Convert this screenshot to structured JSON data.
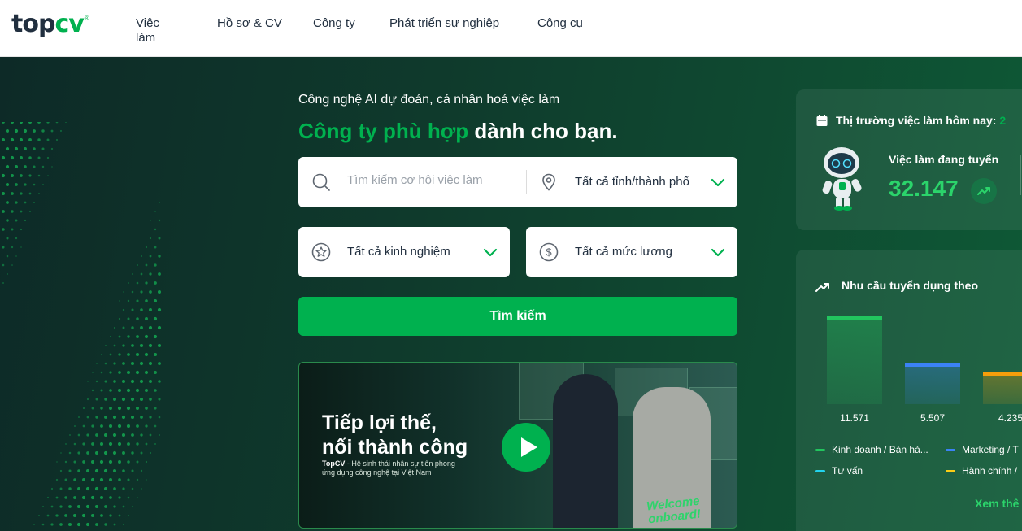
{
  "header": {
    "logo_top": "top",
    "logo_cv": "cv",
    "nav": [
      "Việc làm",
      "Hồ sơ & CV",
      "Công ty",
      "Phát triển sự nghiệp",
      "Công cụ"
    ]
  },
  "hero": {
    "tagline": "Công nghệ AI dự đoán, cá nhân hoá việc làm",
    "headline_accent": "Công ty phù hợp",
    "headline_rest": " dành cho bạn."
  },
  "search": {
    "placeholder": "Tìm kiếm cơ hội việc làm",
    "location": "Tất cả tỉnh/thành phố",
    "experience": "Tất cả kinh nghiệm",
    "salary": "Tất cả mức lương",
    "button": "Tìm kiếm"
  },
  "banner": {
    "title1": "Tiếp lợi thế,",
    "title2": "nối thành công",
    "sub_brand": "TopCV",
    "sub_text": " - Hệ sinh thái nhân sự tiên phong ứng dụng công nghệ tại Việt Nam",
    "welcome1": "Welcome",
    "welcome2": "onboard!"
  },
  "market": {
    "title": "Thị trường việc làm hôm nay:",
    "title_extra": "2",
    "jobs_label": "Việc làm đang tuyển",
    "jobs_value": "32.147"
  },
  "demand": {
    "title": "Nhu cầu tuyển dụng theo",
    "values": [
      "11.571",
      "5.507",
      "4.235"
    ],
    "legend": [
      "Kinh doanh / Bán hà...",
      "Marketing / T",
      "Tư vấn",
      "Hành chính /"
    ],
    "see_more": "Xem thê"
  },
  "chart_data": {
    "type": "bar",
    "categories": [
      "Kinh doanh / Bán hà...",
      "Marketing / T",
      "Tư vấn"
    ],
    "values": [
      11571,
      5507,
      4235
    ],
    "colors": [
      "#22c55e",
      "#3b82f6",
      "#f59e0b"
    ]
  }
}
